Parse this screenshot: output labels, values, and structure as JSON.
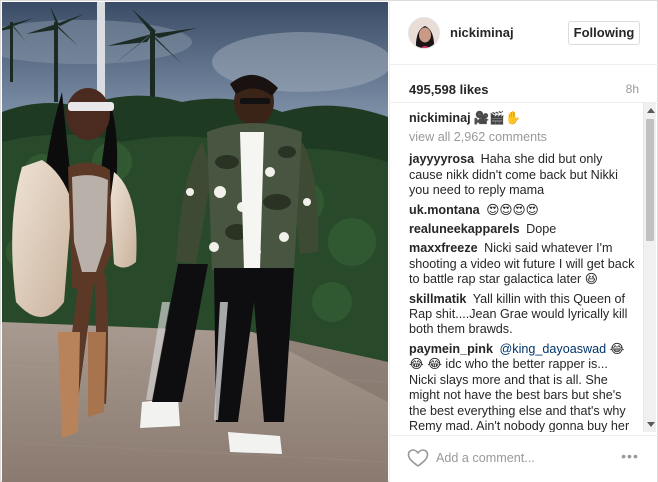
{
  "post": {
    "username": "nickiminaj",
    "follow_label": "Following",
    "likes": "495,598 likes",
    "age": "8h",
    "caption_emoji": "🎥🎬✋",
    "view_all": "view all 2,962 comments",
    "add_comment_placeholder": "Add a comment...",
    "more_label": "•••"
  },
  "comments": [
    {
      "user": "jayyyyrosa",
      "text": "Haha she did but only cause nikk didn't come back but Nikki you need to reply mama"
    },
    {
      "user": "uk.montana",
      "text": "😍😍😍😍"
    },
    {
      "user": "realuneekapparels",
      "text": "Dope"
    },
    {
      "user": "maxxfreeze",
      "text": "Nicki said whatever I'm shooting a video wit future I will get back to battle rap star galactica later 😆"
    },
    {
      "user": "skillmatik",
      "text": "Yall killin with this Queen of Rap shit....Jean Grae would lyrically kill both them brawds."
    },
    {
      "user": "paymein_pink",
      "mention": "@king_dayoaswad",
      "text": "😂😂 😂 idc who the better rapper is... Nicki slays more and that is all. She might not have the best bars but she's the best everything else and that's why Remy mad. Ain't nobody gonna buy her lil album that she about to drop. She"
    }
  ],
  "icons": {
    "heart": "heart-icon",
    "more": "more-options-icon"
  },
  "colors": {
    "text": "#262626",
    "muted": "#999999",
    "border": "#dbdbdb",
    "mention": "#003569"
  }
}
